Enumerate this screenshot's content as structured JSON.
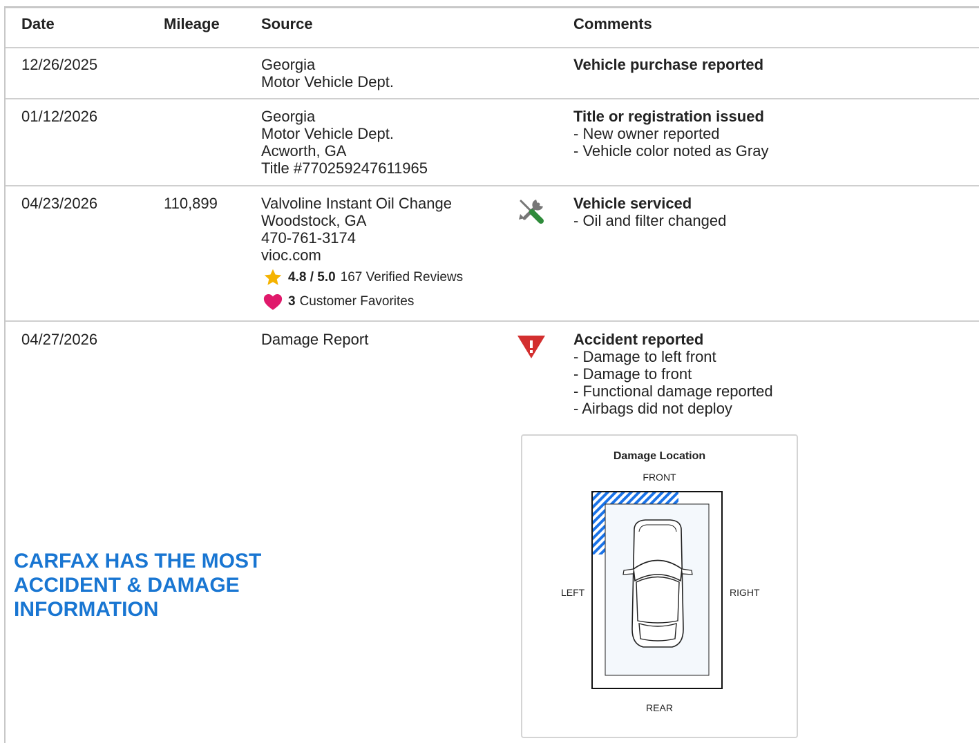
{
  "headers": {
    "date": "Date",
    "mileage": "Mileage",
    "source": "Source",
    "comments": "Comments"
  },
  "rows": [
    {
      "date": "12/26/2025",
      "mileage": "",
      "source": [
        "Georgia",
        "Motor Vehicle Dept."
      ],
      "comment_title": "Vehicle purchase reported",
      "comment_items": []
    },
    {
      "date": "01/12/2026",
      "mileage": "",
      "source": [
        "Georgia",
        "Motor Vehicle Dept.",
        "Acworth, GA",
        "Title #770259247611965"
      ],
      "comment_title": "Title or registration issued",
      "comment_items": [
        "- New owner reported",
        "- Vehicle color noted as Gray"
      ]
    },
    {
      "date": "04/23/2026",
      "mileage": "110,899",
      "source": [
        "Valvoline Instant Oil Change",
        "Woodstock, GA",
        "470-761-3174",
        "vioc.com"
      ],
      "rating": {
        "score": "4.8 / 5.0",
        "reviews": "167 Verified Reviews",
        "favorites_count": "3",
        "favorites_label": "Customer Favorites"
      },
      "icon": "wrench-screwdriver-icon",
      "comment_title": "Vehicle serviced",
      "comment_items": [
        "- Oil and filter changed"
      ]
    },
    {
      "date": "04/27/2026",
      "mileage": "",
      "source": [
        "Damage Report"
      ],
      "icon": "warning-triangle-icon",
      "comment_title": "Accident reported",
      "comment_items": [
        "- Damage to left front",
        "- Damage to front",
        "- Functional damage reported",
        "- Airbags did not deploy"
      ]
    }
  ],
  "promo": {
    "text": "CARFAX HAS THE MOST ACCIDENT & DAMAGE INFORMATION"
  },
  "damage_diagram": {
    "title": "Damage Location",
    "front": "FRONT",
    "rear": "REAR",
    "left": "LEFT",
    "right": "RIGHT",
    "damaged_zones": [
      "left front",
      "front"
    ]
  },
  "colors": {
    "accent_blue": "#1976d2",
    "damage_hatch": "#1a73e8",
    "warning_red": "#d32f2f",
    "star_yellow": "#f5b301",
    "heart_pink": "#e0196b",
    "tool_green": "#2e8b3a"
  }
}
